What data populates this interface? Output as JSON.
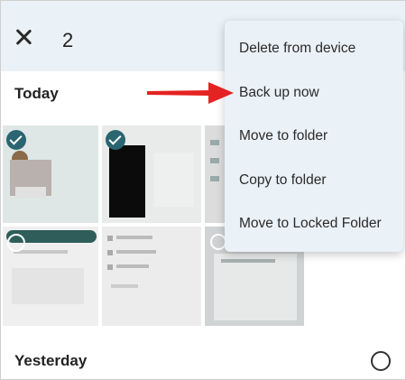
{
  "header": {
    "selected_count": "2"
  },
  "sections": {
    "today_label": "Today",
    "yesterday_label": "Yesterday"
  },
  "thumbnails": [
    {
      "selected": true
    },
    {
      "selected": true
    },
    {
      "selected": false
    },
    {
      "selected": false
    },
    {
      "selected": false
    },
    {
      "selected": false
    }
  ],
  "context_menu": {
    "items": [
      {
        "label": "Delete from device"
      },
      {
        "label": "Back up now"
      },
      {
        "label": "Move to folder"
      },
      {
        "label": "Copy to folder"
      },
      {
        "label": "Move to Locked Folder"
      }
    ]
  },
  "colors": {
    "accent_check": "#2a6571",
    "callout_arrow": "#e42323",
    "header_bg": "#eaf1f7",
    "menu_bg": "#eaf1f7"
  }
}
